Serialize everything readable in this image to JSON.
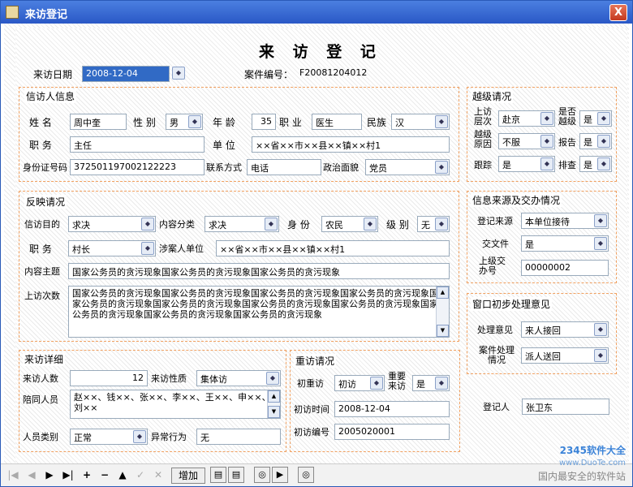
{
  "window": {
    "title": "来访登记",
    "close": "X"
  },
  "form_title": "来 访 登 记",
  "visit_date_label": "来访日期",
  "visit_date": "2008-12-04",
  "case_no_label": "案件编号：",
  "case_no": "F20081204012",
  "petitioner": {
    "title": "信访人信息",
    "name_label": "姓  名",
    "name": "周中奎",
    "gender_label": "性  别",
    "gender": "男",
    "age_label": "年  龄",
    "age": "35",
    "occupation_label": "职  业",
    "occupation": "医生",
    "ethnic_label": "民族",
    "ethnic": "汉",
    "position_label": "职  务",
    "position": "主任",
    "unit_label": "单  位",
    "unit": "××省××市××县××镇××村1",
    "id_label": "身份证号码",
    "id_no": "372501197002122223",
    "contact_label": "联系方式",
    "contact": "电话",
    "political_label": "政治面貌",
    "political": "党员"
  },
  "level": {
    "title": "越级请况",
    "visit_level_label": "上访层次",
    "visit_level": "赴京",
    "is_over_label": "是否越级",
    "is_over": "是",
    "reason_label": "越级原因",
    "reason": "不服",
    "report_label": "报告",
    "report": "是",
    "follow_label": "跟踪",
    "follow": "是",
    "check_label": "排查",
    "check": "是"
  },
  "report": {
    "title": "反映请况",
    "purpose_label": "信访目的",
    "purpose": "求决",
    "category_label": "内容分类",
    "category": "求决",
    "identity_label": "身  份",
    "identity": "农民",
    "rank_label": "级  别",
    "rank": "无",
    "duty_label": "职  务",
    "duty": "村长",
    "involved_unit_label": "涉案人单位",
    "involved_unit": "××省××市××县××镇××村1",
    "subject_label": "内容主题",
    "subject": "国家公务员的贪污现象国家公务员的贪污现象国家公务员的贪污现象",
    "times_label": "上访次数",
    "times_text": "国家公务员的贪污现象国家公务员的贪污现象国家公务员的贪污现象国家公务员的贪污现象国家公务员的贪污现象国家公务员的贪污现象国家公务员的贪污现象国家公务员的贪污现象国家公务员的贪污现象国家公务员的贪污现象国家公务员的贪污现象"
  },
  "source": {
    "title": "信息来源及交办情况",
    "reg_source_label": "登记来源",
    "reg_source": "本单位接待",
    "transfer_label": "交文件",
    "transfer": "是",
    "upper_no_label": "上级交办号",
    "upper_no": "00000002"
  },
  "window_opinion": {
    "title": "窗口初步处理意见",
    "opinion_label": "处理意见",
    "opinion": "来人接回",
    "case_handling_label": "案件处理情况",
    "case_handling": "派人送回"
  },
  "detail": {
    "title": "来访详细",
    "count_label": "来访人数",
    "count": "12",
    "nature_label": "来访性质",
    "nature": "集体访",
    "accomp_label": "陪同人员",
    "accomp": "赵××、钱××、张××、李××、王××、申××、刘××",
    "type_label": "人员类别",
    "type": "正常",
    "abnormal_label": "异常行为",
    "abnormal": "无"
  },
  "repeat": {
    "title": "重访请况",
    "first_label": "初重访",
    "first": "初访",
    "important_label": "重要来访",
    "important": "是",
    "first_time_label": "初访时间",
    "first_time": "2008-12-04",
    "first_no_label": "初访编号",
    "first_no": "2005020001"
  },
  "registrar_label": "登记人",
  "registrar": "张卫东",
  "toolbar": {
    "add": "增加",
    "first": "|◀",
    "prev": "◀",
    "next": "▶",
    "last": "▶|",
    "plus": "+",
    "minus": "−",
    "up": "▲",
    "check": "✓",
    "cancel": "✕"
  },
  "watermark": {
    "line1": "2345软件大全",
    "line2": "www.DuoTe.com",
    "line3": "国内最安全的软件站"
  }
}
